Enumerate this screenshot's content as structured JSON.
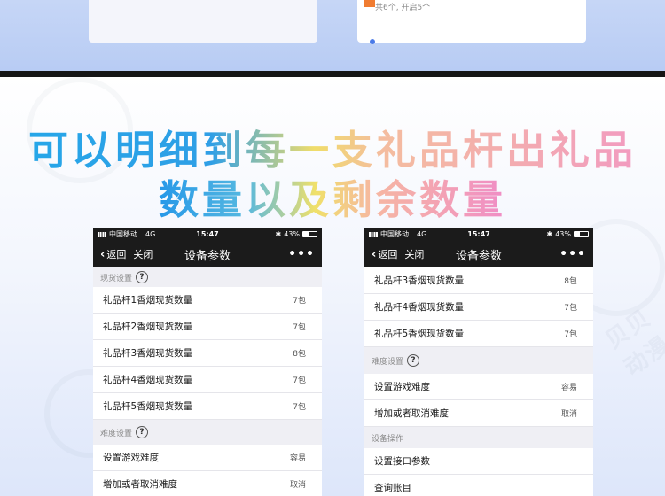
{
  "top": {
    "count_text": "共6个, 开启5个"
  },
  "headline": {
    "line1": "可以明细到每一支礼品杆出礼品",
    "line2": "数量以及剩余数量"
  },
  "watermark": "贝贝动漫",
  "left_phone": {
    "status": {
      "carrier": "中国移动",
      "network": "4G",
      "time": "15:47",
      "battery": "43%"
    },
    "nav": {
      "back": "返回",
      "close": "关闭",
      "title": "设备参数",
      "more": "•••"
    },
    "stock_section": {
      "title": "现货设置",
      "rows": [
        {
          "label": "礼品杆1香烟现货数量",
          "value": "7包"
        },
        {
          "label": "礼品杆2香烟现货数量",
          "value": "7包"
        },
        {
          "label": "礼品杆3香烟现货数量",
          "value": "8包"
        },
        {
          "label": "礼品杆4香烟现货数量",
          "value": "7包"
        },
        {
          "label": "礼品杆5香烟现货数量",
          "value": "7包"
        }
      ]
    },
    "difficulty_section": {
      "title": "难度设置",
      "rows": [
        {
          "label": "设置游戏难度",
          "value": "容易"
        },
        {
          "label": "增加或者取消难度",
          "value": "取消"
        }
      ]
    }
  },
  "right_phone": {
    "status": {
      "carrier": "中国移动",
      "network": "4G",
      "time": "15:47",
      "battery": "43%"
    },
    "nav": {
      "back": "返回",
      "close": "关闭",
      "title": "设备参数",
      "more": "•••"
    },
    "stock_rows": [
      {
        "label": "礼品杆3香烟现货数量",
        "value": "8包"
      },
      {
        "label": "礼品杆4香烟现货数量",
        "value": "7包"
      },
      {
        "label": "礼品杆5香烟现货数量",
        "value": "7包"
      }
    ],
    "difficulty_section": {
      "title": "难度设置",
      "rows": [
        {
          "label": "设置游戏难度",
          "value": "容易"
        },
        {
          "label": "增加或者取消难度",
          "value": "取消"
        }
      ]
    },
    "device_section": {
      "title": "设备操作",
      "rows": [
        {
          "label": "设置接口参数"
        },
        {
          "label": "查询账目"
        }
      ]
    }
  },
  "colors": {
    "headline_blue": "#26a6e8",
    "headline_yellow": "#f0dd6a",
    "headline_pink": "#f29bc0",
    "nav_bg": "#1b1b1b",
    "page_bg": "#efeff4"
  }
}
